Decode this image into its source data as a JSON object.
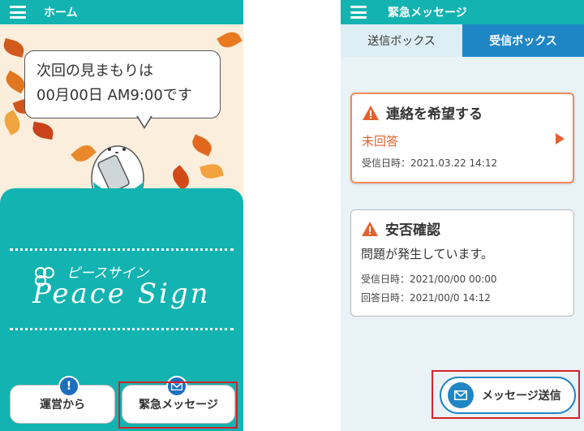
{
  "home": {
    "title": "ホーム",
    "bubble_text": "次回の見まもりは\n00月00日 AM9:00です",
    "logo_kana": "ピースサイン",
    "logo_text": "Peace Sign",
    "buttons": {
      "ops_label": "運営から",
      "emergency_label": "緊急メッセージ"
    }
  },
  "emergency": {
    "title": "緊急メッセージ",
    "tabs": [
      {
        "label": "送信ボックス",
        "selected": false
      },
      {
        "label": "受信ボックス",
        "selected": true
      }
    ],
    "cards": [
      {
        "heading": "連絡を希望する",
        "status": "未回答",
        "received": "受信日時：2021.03.22 14:12"
      },
      {
        "heading": "安否確認",
        "body": "問題が発生しています。",
        "received": "受信日時：2021/00/00 00:00",
        "answered": "回答日時：2021/00/0 14:12"
      }
    ],
    "send_button_label": "メッセージ送信"
  },
  "colors": {
    "teal": "#12b3b0",
    "blue": "#1f86c6",
    "warning": "#e3622f",
    "highlight": "#d3222a"
  },
  "icons": [
    "menu-icon",
    "info-icon",
    "mail-icon",
    "warning-icon",
    "play-arrow-icon"
  ]
}
